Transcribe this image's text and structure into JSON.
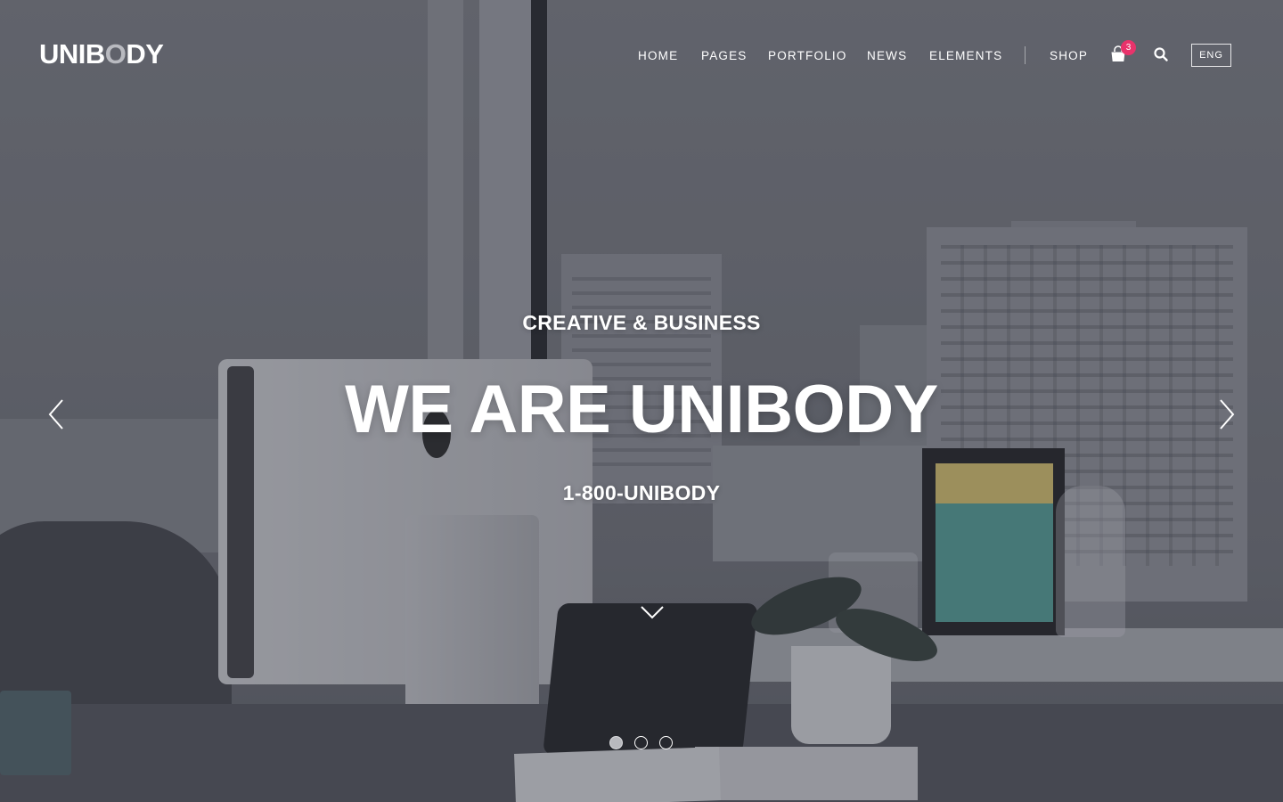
{
  "brand": {
    "logo_prefix": "UNIB",
    "logo_dim": "O",
    "logo_suffix": "DY"
  },
  "nav": {
    "items": [
      {
        "label": "HOME"
      },
      {
        "label": "PAGES"
      },
      {
        "label": "PORTFOLIO"
      },
      {
        "label": "NEWS"
      },
      {
        "label": "ELEMENTS"
      }
    ],
    "shop_label": "SHOP",
    "cart_count": "3",
    "cart_icon": "shopping-bag-icon",
    "search_icon": "search-icon",
    "language": "ENG"
  },
  "hero": {
    "eyebrow": "CREATIVE & BUSINESS",
    "headline": "WE ARE UNIBODY",
    "phone": "1-800-UNIBODY",
    "prev_icon": "chevron-left-icon",
    "next_icon": "chevron-right-icon",
    "scroll_icon": "chevron-down-icon",
    "slides": {
      "count": 3,
      "active": 1
    }
  },
  "colors": {
    "badge": "#e8336b",
    "text": "#ffffff",
    "overlay": "#3a3c46"
  }
}
